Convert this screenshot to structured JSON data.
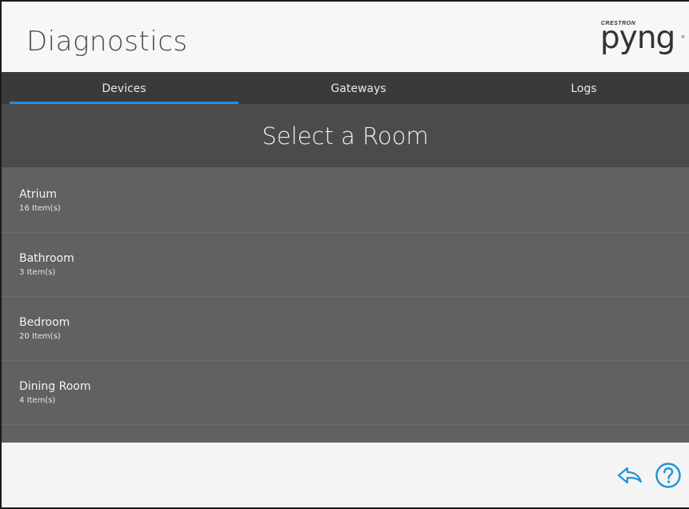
{
  "header": {
    "title": "Diagnostics",
    "logo_top": "CRESTRON",
    "logo_main": "pyng",
    "logo_reg": "®"
  },
  "tabs": [
    {
      "label": "Devices",
      "active": true
    },
    {
      "label": "Gateways",
      "active": false
    },
    {
      "label": "Logs",
      "active": false
    }
  ],
  "room_header": {
    "title": "Select a Room"
  },
  "rooms": [
    {
      "name": "Atrium",
      "count": "16 Item(s)"
    },
    {
      "name": "Bathroom",
      "count": "3 Item(s)"
    },
    {
      "name": "Bedroom",
      "count": "20 Item(s)"
    },
    {
      "name": "Dining Room",
      "count": "4 Item(s)"
    }
  ],
  "footer": {
    "back_icon": "back-arrow-icon",
    "help_icon": "help-icon"
  },
  "colors": {
    "accent": "#1f93d9",
    "tabbar": "#3a3a3a",
    "room_header": "#4b4b4b",
    "list_bg": "#616161"
  }
}
